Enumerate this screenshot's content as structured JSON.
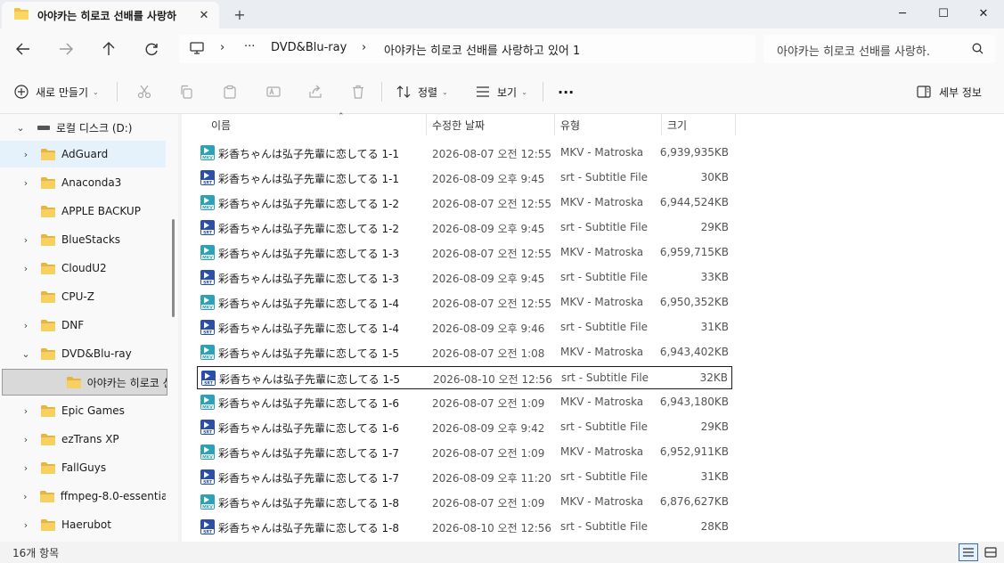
{
  "window": {
    "tab_title": "아야카는 히로코 선배를 사랑하",
    "tab_close": "✕",
    "new_tab": "+",
    "minimize": "─",
    "maximize": "☐",
    "close": "✕"
  },
  "address": {
    "more": "···",
    "crumb_1": "DVD&Blu-ray",
    "crumb_2": "아야카는 히로코 선배를 사랑하고 있어 1",
    "sep": "›",
    "search_placeholder": "아야카는 히로코 선배를 사랑하."
  },
  "toolbar": {
    "new_label": "새로 만들기",
    "sort_label": "정렬",
    "view_label": "보기",
    "more_label": "···",
    "details_label": "세부 정보"
  },
  "sidebar": {
    "drive": "로컬 디스크 (D:)",
    "items": [
      {
        "label": "AdGuard",
        "twisty": "›",
        "state": "hover"
      },
      {
        "label": "Anaconda3",
        "twisty": "›",
        "state": ""
      },
      {
        "label": "APPLE BACKUP",
        "twisty": "",
        "state": ""
      },
      {
        "label": "BlueStacks",
        "twisty": "›",
        "state": ""
      },
      {
        "label": "CloudU2",
        "twisty": "›",
        "state": ""
      },
      {
        "label": "CPU-Z",
        "twisty": "",
        "state": ""
      },
      {
        "label": "DNF",
        "twisty": "›",
        "state": ""
      },
      {
        "label": "DVD&Blu-ray",
        "twisty": "⌄",
        "state": ""
      },
      {
        "label": "아야카는 히로코 선배",
        "twisty": "",
        "state": "selected"
      },
      {
        "label": "Epic Games",
        "twisty": "›",
        "state": ""
      },
      {
        "label": "ezTrans XP",
        "twisty": "›",
        "state": ""
      },
      {
        "label": "FallGuys",
        "twisty": "›",
        "state": ""
      },
      {
        "label": "ffmpeg-8.0-essentials",
        "twisty": "›",
        "state": ""
      },
      {
        "label": "Haerubot",
        "twisty": "›",
        "state": ""
      }
    ]
  },
  "columns": {
    "name": "이름",
    "date": "수정한 날짜",
    "type": "유형",
    "size": "크기"
  },
  "files": [
    {
      "name": "彩香ちゃんは弘子先輩に恋してる 1-1",
      "date": "2026-08-07 오전 12:55",
      "type": "MKV - Matroska",
      "size": "6,939,935KB",
      "kind": "mkv"
    },
    {
      "name": "彩香ちゃんは弘子先輩に恋してる 1-1",
      "date": "2026-08-09 오후 9:45",
      "type": "srt - Subtitle File",
      "size": "30KB",
      "kind": "srt"
    },
    {
      "name": "彩香ちゃんは弘子先輩に恋してる 1-2",
      "date": "2026-08-07 오전 12:55",
      "type": "MKV - Matroska",
      "size": "6,944,524KB",
      "kind": "mkv"
    },
    {
      "name": "彩香ちゃんは弘子先輩に恋してる 1-2",
      "date": "2026-08-09 오후 9:45",
      "type": "srt - Subtitle File",
      "size": "29KB",
      "kind": "srt"
    },
    {
      "name": "彩香ちゃんは弘子先輩に恋してる 1-3",
      "date": "2026-08-07 오전 12:55",
      "type": "MKV - Matroska",
      "size": "6,959,715KB",
      "kind": "mkv"
    },
    {
      "name": "彩香ちゃんは弘子先輩に恋してる 1-3",
      "date": "2026-08-09 오후 9:45",
      "type": "srt - Subtitle File",
      "size": "33KB",
      "kind": "srt"
    },
    {
      "name": "彩香ちゃんは弘子先輩に恋してる 1-4",
      "date": "2026-08-07 오전 12:55",
      "type": "MKV - Matroska",
      "size": "6,950,352KB",
      "kind": "mkv"
    },
    {
      "name": "彩香ちゃんは弘子先輩に恋してる 1-4",
      "date": "2026-08-09 오후 9:46",
      "type": "srt - Subtitle File",
      "size": "31KB",
      "kind": "srt"
    },
    {
      "name": "彩香ちゃんは弘子先輩に恋してる 1-5",
      "date": "2026-08-07 오전 1:08",
      "type": "MKV - Matroska",
      "size": "6,943,402KB",
      "kind": "mkv"
    },
    {
      "name": "彩香ちゃんは弘子先輩に恋してる 1-5",
      "date": "2026-08-10 오전 12:56",
      "type": "srt - Subtitle File",
      "size": "32KB",
      "kind": "srt",
      "focused": true
    },
    {
      "name": "彩香ちゃんは弘子先輩に恋してる 1-6",
      "date": "2026-08-07 오전 1:09",
      "type": "MKV - Matroska",
      "size": "6,943,180KB",
      "kind": "mkv"
    },
    {
      "name": "彩香ちゃんは弘子先輩に恋してる 1-6",
      "date": "2026-08-09 오후 9:42",
      "type": "srt - Subtitle File",
      "size": "29KB",
      "kind": "srt"
    },
    {
      "name": "彩香ちゃんは弘子先輩に恋してる 1-7",
      "date": "2026-08-07 오전 1:09",
      "type": "MKV - Matroska",
      "size": "6,952,911KB",
      "kind": "mkv"
    },
    {
      "name": "彩香ちゃんは弘子先輩に恋してる 1-7",
      "date": "2026-08-09 오후 11:20",
      "type": "srt - Subtitle File",
      "size": "31KB",
      "kind": "srt"
    },
    {
      "name": "彩香ちゃんは弘子先輩に恋してる 1-8",
      "date": "2026-08-07 오전 1:09",
      "type": "MKV - Matroska",
      "size": "6,876,627KB",
      "kind": "mkv"
    },
    {
      "name": "彩香ちゃんは弘子先輩に恋してる 1-8",
      "date": "2026-08-10 오전 12:56",
      "type": "srt - Subtitle File",
      "size": "28KB",
      "kind": "srt"
    }
  ],
  "status": {
    "count": "16개 항목"
  },
  "colors": {
    "folder": "#f3c13a",
    "mkv_icon": "#2aa3b8",
    "srt_icon": "#2b4fa8",
    "selection": "#e5f1fb"
  }
}
